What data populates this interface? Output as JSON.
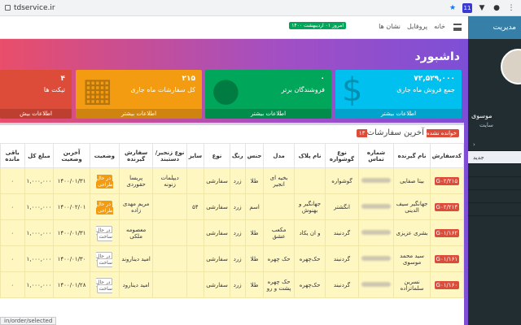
{
  "browser": {
    "url": "tdservice.ir"
  },
  "topnav": {
    "links": [
      "خانه",
      "پروفایل",
      "نشان ها"
    ],
    "today": "امروز ۰۱ اردیبهشت ۱۴۰۰"
  },
  "sidebar": {
    "header": "مدیریت",
    "user_name": "موسوی",
    "user_role": "سایت",
    "items": [
      "",
      "جدید",
      "",
      "",
      "",
      ""
    ]
  },
  "dashboard": {
    "title": "داشبورد",
    "boxes": [
      {
        "num": "۷۲,۵۲۹,۰۰۰",
        "label": "جمع فروش ماه جاری",
        "footer": "اطلاعات بیشتر",
        "color": "#00c0ef"
      },
      {
        "num": "۰",
        "label": "فروشندگان برتر",
        "footer": "اطلاعات بیشتر",
        "color": "#00a65a"
      },
      {
        "num": "۲۱۵",
        "label": "کل سفارشات ماه جاری",
        "footer": "اطلاعات بیشتر",
        "color": "#f39c12"
      },
      {
        "num": "۴",
        "label": "تیکت ها",
        "footer": "اطلاعات بیش",
        "color": "#dd4b39"
      }
    ]
  },
  "orders": {
    "title": "آخرین سفارشات",
    "badge": "۱۳ خوانده نشده",
    "columns": [
      "کدسفارش",
      "نام گیرنده",
      "شماره تماس",
      "نوع گوشواره",
      "نام پلاک",
      "مدل",
      "جنس",
      "رنگ",
      "نوع",
      "سایز",
      "نوع زنجیر/ دستبند",
      "سفارش گیرنده",
      "وضعیت",
      "آخرین وضعیت",
      "مبلغ کل",
      "باقی مانده"
    ],
    "rows": [
      [
        "G۰۲/۲۱۵",
        "بیتا صفایی",
        "",
        "گوشواره",
        "",
        "بخیه ای انجیر",
        "طلا",
        "زرد",
        "سفارشی",
        "",
        "دیپلمات زنونه",
        "پریسا حقوردی",
        "در حال طراحی",
        "۱۴۰۰/۰۱/۳۱",
        "۱,۰۰۰,۰۰۰",
        "۰"
      ],
      [
        "G۰۲/۲۱۴",
        "جهانگیر سیف الدینی",
        "",
        "انگشتر",
        "جهانگیر و بهنوش",
        "",
        "اسم",
        "زرد",
        "سفارشی",
        "۵۴",
        "",
        "مریم مهدی زاده",
        "در حال طراحی",
        "۱۴۰۰/۰۲/۰۱",
        "۱,۰۰۰,۰۰۰",
        "۰"
      ],
      [
        "G۰۱/۱۶۲",
        "بشری عزیزی",
        "",
        "گردنبند",
        "و ان یکاد",
        "مکعب عشق",
        "طلا",
        "زرد",
        "سفارشی",
        "",
        "",
        "معصومه ملکی",
        "در حال ساخت",
        "۱۴۰۰/۰۱/۳۱",
        "۱,۰۰۰,۰۰۰",
        "۰"
      ],
      [
        "G۰۱/۱۶۱",
        "سید محمد موسوی",
        "",
        "گردنبند",
        "حک‌چهره",
        "حک چهره",
        "طلا",
        "زرد",
        "سفارشی",
        "",
        "",
        "امید دیناروند",
        "در حال ساخت",
        "۱۴۰۰/۰۱/۳۰",
        "۱,۰۰۰,۰۰۰",
        "۰"
      ],
      [
        "G۰۱/۱۶۰",
        "نسرین سلماتزاده",
        "",
        "گردنبند",
        "حک‌چهره",
        "حک چهره پشت و رو",
        "طلا",
        "زرد",
        "سفارشی",
        "",
        "",
        "امید دینارود",
        "در حال ساخت",
        "۱۴۰۰/۰۱/۲۸",
        "۱,۰۰۰,۰۰۰",
        "۰"
      ]
    ]
  },
  "statusbar": "in/order/selected"
}
